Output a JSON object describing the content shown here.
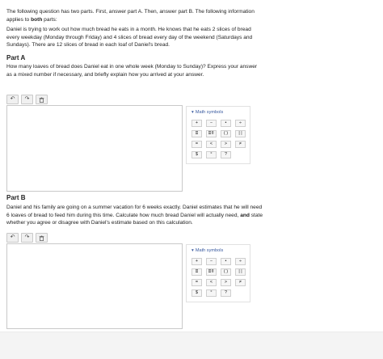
{
  "intro": {
    "before_bold": "The following question has two parts. First, answer part A. Then, answer part B. The following information applies to ",
    "bold": "both",
    "after_bold": " parts:"
  },
  "story": "Daniel is trying to work out how much bread he eats in a month. He knows that he eats 2 slices of bread every weekday (Monday through Friday) and 4 slices of bread every day of the weekend (Saturdays and Sundays). There are 12 slices of bread in each loaf of Daniel's bread.",
  "partA": {
    "title": "Part A",
    "question": "How many loaves of bread does Daniel eat in one whole week (Monday to Sunday)? Express your answer as a mixed number if necessary, and briefly explain how you arrived at your answer."
  },
  "partB": {
    "title": "Part B",
    "question_before_bold": "Daniel and his family are going on a summer vacation for 6 weeks exactly. Daniel estimates that he will need 6 loaves of bread to feed him during this time. Calculate how much bread Daniel will actually need, ",
    "bold": "and",
    "question_after_bold": " state whether you agree or disagree with Daniel's estimate based on this calculation."
  },
  "toolbar": {
    "undo_icon": "↶",
    "redo_icon": "↷",
    "delete_icon": "🗑"
  },
  "math": {
    "header": "Math symbols",
    "caret": "▾",
    "keys": [
      "+",
      "−",
      "•",
      "÷",
      "⌸",
      "⌸▯",
      "( )",
      "| |",
      "=",
      "<",
      ">",
      "≠",
      "$",
      "°",
      "?"
    ]
  }
}
